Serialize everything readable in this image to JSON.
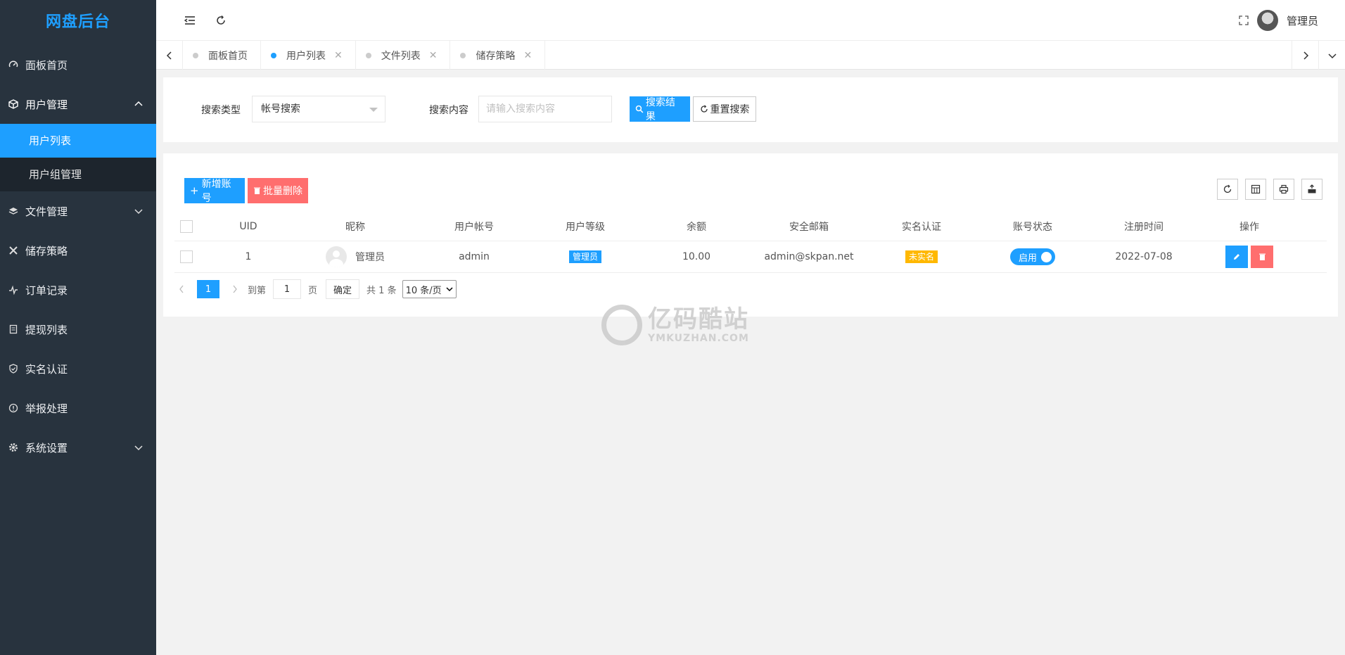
{
  "app": {
    "title": "网盘后台"
  },
  "sidebar": {
    "items": [
      {
        "label": "面板首页"
      },
      {
        "label": "用户管理",
        "children": [
          {
            "label": "用户列表"
          },
          {
            "label": "用户组管理"
          }
        ]
      },
      {
        "label": "文件管理"
      },
      {
        "label": "储存策略"
      },
      {
        "label": "订单记录"
      },
      {
        "label": "提现列表"
      },
      {
        "label": "实名认证"
      },
      {
        "label": "举报处理"
      },
      {
        "label": "系统设置"
      }
    ]
  },
  "header": {
    "user_name": "管理员"
  },
  "tabs": [
    {
      "label": "面板首页"
    },
    {
      "label": "用户列表"
    },
    {
      "label": "文件列表"
    },
    {
      "label": "储存策略"
    }
  ],
  "search": {
    "type_label": "搜索类型",
    "type_value": "帐号搜索",
    "content_label": "搜索内容",
    "content_placeholder": "请输入搜索内容",
    "search_button": "搜索结果",
    "reset_button": "重置搜索"
  },
  "toolbar": {
    "add_button": "新增账号",
    "batch_delete_button": "批量删除"
  },
  "table": {
    "headers": [
      "UID",
      "昵称",
      "用户帐号",
      "用户等级",
      "余额",
      "安全邮箱",
      "实名认证",
      "账号状态",
      "注册时间",
      "操作"
    ],
    "rows": [
      {
        "uid": "1",
        "nickname": "管理员",
        "account": "admin",
        "level": "管理员",
        "balance": "10.00",
        "email": "admin@skpan.net",
        "realname": "未实名",
        "status": "启用",
        "reg_time": "2022-07-08"
      }
    ]
  },
  "pager": {
    "current": "1",
    "goto_label": "到第",
    "goto_value": "1",
    "page_unit": "页",
    "confirm": "确定",
    "total": "共 1 条",
    "per_page": "10 条/页"
  },
  "watermark": {
    "cn": "亿码酷站",
    "en": "YMKUZHAN.COM"
  },
  "colors": {
    "accent": "#1e9fff",
    "sidebar_bg": "#28333e",
    "danger": "#ff5f5f",
    "warning": "#ffb800"
  }
}
